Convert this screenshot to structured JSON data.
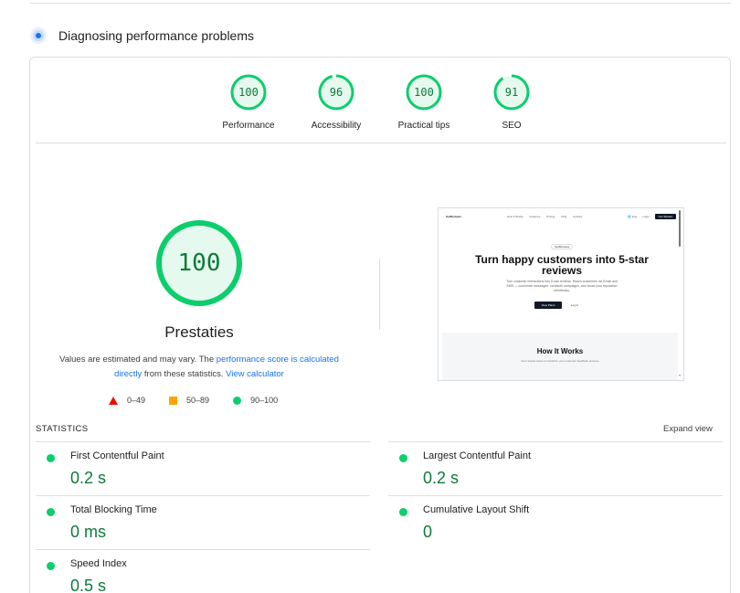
{
  "header": {
    "title": "Diagnosing performance problems"
  },
  "categories": [
    {
      "label": "Performance",
      "score": "100",
      "fraction": 1.0
    },
    {
      "label": "Accessibility",
      "score": "96",
      "fraction": 0.96
    },
    {
      "label": "Practical tips",
      "score": "100",
      "fraction": 1.0
    },
    {
      "label": "SEO",
      "score": "91",
      "fraction": 0.91
    }
  ],
  "main_gauge": {
    "score": "100",
    "fraction": 1.0,
    "title": "Prestaties",
    "desc_prefix": "Values are estimated and may vary. The ",
    "desc_link1": "performance score is calculated directly",
    "desc_mid": " from these statistics. ",
    "desc_link2": "View calculator"
  },
  "legend": {
    "fail": "0–49",
    "average": "50–89",
    "pass": "90–100"
  },
  "screenshot": {
    "brand": "GetReviews",
    "nav_links": [
      "How it Works",
      "Features",
      "Pricing",
      "FAQ",
      "Contact"
    ],
    "nav_lang": "🌐 Eng",
    "nav_login": "Login",
    "nav_cta": "Get Started",
    "badge": "GetReviews",
    "headline": "Turn happy customers into 5-star reviews",
    "subtext": "Turn customer interactions into 5-star reviews. Reach customers via Email and SMS — customize messages, schedule campaigns, and boost your reputation effortlessly.",
    "btn_primary": "View Plans",
    "btn_secondary": "Log In",
    "section_title": "How It Works",
    "section_sub": "Four simple steps to transform your customer feedback process"
  },
  "statistics": {
    "label": "STATISTICS",
    "expand": "Expand view",
    "metrics": [
      {
        "label": "First Contentful Paint",
        "value": "0.2 s"
      },
      {
        "label": "Largest Contentful Paint",
        "value": "0.2 s"
      },
      {
        "label": "Total Blocking Time",
        "value": "0 ms"
      },
      {
        "label": "Cumulative Layout Shift",
        "value": "0"
      },
      {
        "label": "Speed Index",
        "value": "0.5 s"
      }
    ]
  },
  "colors": {
    "pass": "#0cce6b",
    "pass_text": "#0c7a3a",
    "pass_bg": "#e6f9ef",
    "average": "#ffa400",
    "fail": "#eb0f00",
    "link": "#1a73e8"
  }
}
